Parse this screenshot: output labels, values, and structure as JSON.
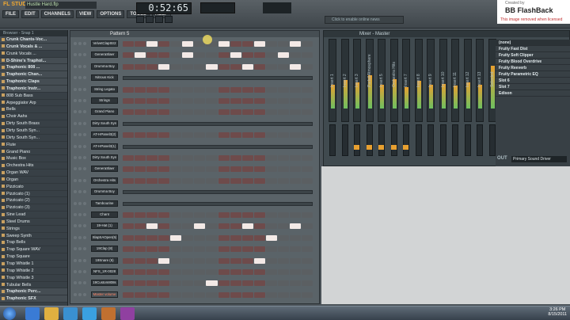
{
  "app": {
    "logo": "FL STUDIO",
    "file": "Hustle Hard.flp"
  },
  "menu": [
    "FILE",
    "EDIT",
    "CHANNELS",
    "VIEW",
    "OPTIONS",
    "TOOLS",
    "HELP"
  ],
  "transport": {
    "time": "0:52:65"
  },
  "hint": "Click to enable online news",
  "watermark": {
    "line1": "Created by",
    "line2": "BB FlashBack",
    "line3": "This image removed when licensed"
  },
  "browser": {
    "header": "Browser - Snap 1",
    "items": [
      {
        "label": "Crunk Chants-Voc...",
        "folder": true
      },
      {
        "label": "Crunk Vocals & ...",
        "folder": true
      },
      {
        "label": "Crunk Vocals ...",
        "folder": false
      },
      {
        "label": "D-Shine's Traphol...",
        "folder": true
      },
      {
        "label": "Traphonic 808 ...",
        "folder": true
      },
      {
        "label": "Traphonic Chan...",
        "folder": true
      },
      {
        "label": "Traphonic Claps",
        "folder": true
      },
      {
        "label": "Traphonic Instr...",
        "folder": true
      },
      {
        "label": "808 Sub Bass",
        "folder": false
      },
      {
        "label": "Arpeggiator Arp",
        "folder": false
      },
      {
        "label": "Bells",
        "folder": false
      },
      {
        "label": "Choir Aahs",
        "folder": false
      },
      {
        "label": "Dirty South Brass",
        "folder": false
      },
      {
        "label": "Dirty South Syn...",
        "folder": false
      },
      {
        "label": "Dirty South Syn...",
        "folder": false
      },
      {
        "label": "Flute",
        "folder": false
      },
      {
        "label": "Grand Piano",
        "folder": false
      },
      {
        "label": "Music Box",
        "folder": false
      },
      {
        "label": "Orchestra Hits",
        "folder": false
      },
      {
        "label": "Organ WAV",
        "folder": false
      },
      {
        "label": "Organ",
        "folder": false
      },
      {
        "label": "Pizzicato",
        "folder": false
      },
      {
        "label": "Pizzicato (1)",
        "folder": false
      },
      {
        "label": "Pizzicato (2)",
        "folder": false
      },
      {
        "label": "Pizzicato (3)",
        "folder": false
      },
      {
        "label": "Sine Lead",
        "folder": false
      },
      {
        "label": "Steel Drums",
        "folder": false
      },
      {
        "label": "Strings",
        "folder": false
      },
      {
        "label": "Sweep Synth",
        "folder": false
      },
      {
        "label": "Trap Bells",
        "folder": false
      },
      {
        "label": "Trap Square WAV",
        "folder": false
      },
      {
        "label": "Trap Square",
        "folder": false
      },
      {
        "label": "Trap Whistle 1",
        "folder": false
      },
      {
        "label": "Trap Whistle 2",
        "folder": false
      },
      {
        "label": "Trap Whistle 3",
        "folder": false
      },
      {
        "label": "Tubular Bells",
        "folder": false
      },
      {
        "label": "Traphonic Perc...",
        "folder": true
      },
      {
        "label": "Traphonic SFX",
        "folder": true
      }
    ]
  },
  "pattern": {
    "label": "Pattern 5"
  },
  "channels": [
    {
      "name": "VelvetClapStr2",
      "kind": "steps",
      "on": [
        2,
        5,
        8,
        11,
        14
      ]
    },
    {
      "name": "GeneraSlaer",
      "kind": "steps",
      "on": [
        1,
        5,
        9,
        13
      ]
    },
    {
      "name": "Drumma Boy",
      "kind": "steps",
      "on": [
        3,
        7,
        10,
        14
      ]
    },
    {
      "name": "Nitrous Kick",
      "kind": "roll"
    },
    {
      "name": "String Legato",
      "kind": "steps",
      "on": []
    },
    {
      "name": "Strings",
      "kind": "steps",
      "on": []
    },
    {
      "name": "Grand Piano",
      "kind": "steps",
      "on": []
    },
    {
      "name": "Dirty South Syn",
      "kind": "roll"
    },
    {
      "name": "AT-HPanel3(2)",
      "kind": "steps",
      "on": []
    },
    {
      "name": "AT-HPanel3(1)",
      "kind": "roll"
    },
    {
      "name": "Dirty South Syn",
      "kind": "steps",
      "on": []
    },
    {
      "name": "GeneraSlaer",
      "kind": "steps",
      "on": []
    },
    {
      "name": "Orchestra Hits",
      "kind": "steps",
      "on": []
    },
    {
      "name": "Drumma Boy",
      "kind": "roll"
    },
    {
      "name": "Tambourine",
      "kind": "roll"
    },
    {
      "name": "Chant",
      "kind": "steps",
      "on": []
    },
    {
      "name": "19-Hat (1)",
      "kind": "steps",
      "on": [
        2,
        6,
        10,
        14
      ]
    },
    {
      "name": "SlapSAOpen(5)",
      "kind": "steps",
      "on": [
        4,
        12
      ]
    },
    {
      "name": "19Clap (8)",
      "kind": "steps",
      "on": []
    },
    {
      "name": "19Snare (6)",
      "kind": "steps",
      "on": [
        3,
        11
      ]
    },
    {
      "name": "NFS_1R-0028",
      "kind": "steps",
      "on": []
    },
    {
      "name": "19Custom808s",
      "kind": "steps",
      "on": [
        7
      ]
    },
    {
      "name": "Master volume",
      "kind": "steps",
      "on": []
    }
  ],
  "mixer": {
    "title": "Mixer - Master",
    "tracks": [
      "Insert 1",
      "Insert 2",
      "Insert 3",
      "Pads&Atmosphere",
      "Insert 5",
      "Orchestra Hits",
      "Insert 7",
      "Insert 8",
      "Insert 9",
      "Insert 10",
      "Insert 11",
      "Insert 12",
      "Insert 13",
      "Selected"
    ]
  },
  "fx": {
    "header": "(none)",
    "slots": [
      "Fruity Fast Dist",
      "Fruity Soft Clipper",
      "Fruity Blood Overdrive",
      "Fruity Reeverb",
      "Fruity Parametric EQ",
      "Slot 6",
      "Slot 7",
      "Edison"
    ],
    "out_label": "OUT",
    "out": "Primary Sound Driver"
  },
  "tray": {
    "time": "3:26 PM",
    "date": "8/15/2011"
  }
}
